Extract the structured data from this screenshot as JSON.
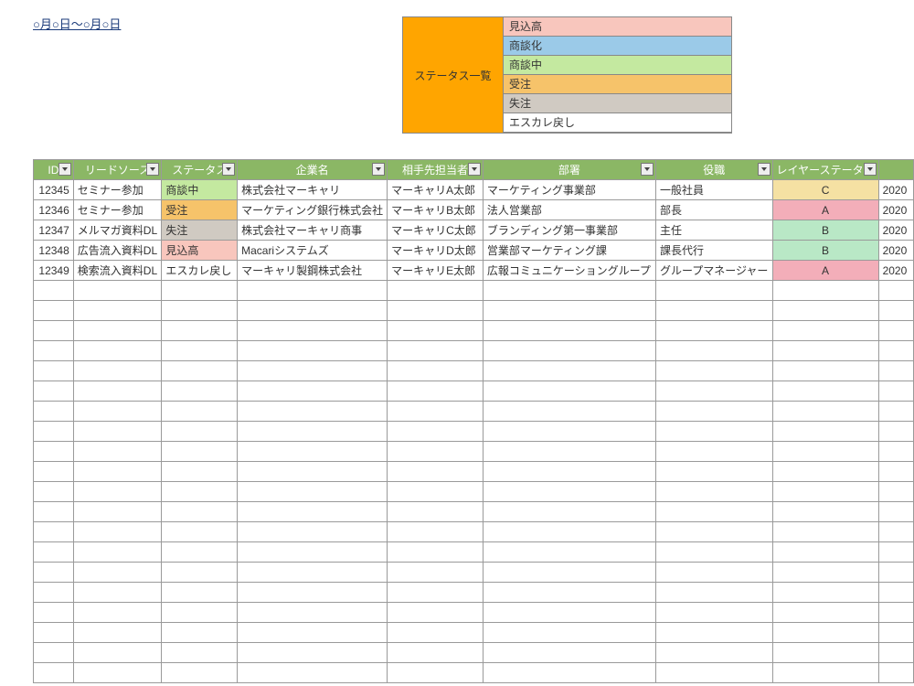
{
  "title_link": "○月○日～○月○日",
  "legend": {
    "header": "ステータス一覧",
    "items": [
      {
        "label": "見込高",
        "class": "bg-mikomi"
      },
      {
        "label": "商談化",
        "class": "bg-shodanka"
      },
      {
        "label": "商談中",
        "class": "bg-shodanchu"
      },
      {
        "label": "受注",
        "class": "bg-juchu"
      },
      {
        "label": "失注",
        "class": "bg-shicchu"
      },
      {
        "label": "エスカレ戻し",
        "class": "bg-escare"
      }
    ]
  },
  "table": {
    "columns": [
      {
        "key": "id",
        "label": "ID"
      },
      {
        "key": "lead",
        "label": "リードソース"
      },
      {
        "key": "status",
        "label": "ステータス"
      },
      {
        "key": "company",
        "label": "企業名"
      },
      {
        "key": "contact",
        "label": "相手先担当者"
      },
      {
        "key": "dept",
        "label": "部署"
      },
      {
        "key": "pos",
        "label": "役職"
      },
      {
        "key": "layer",
        "label": "レイヤーステータス"
      },
      {
        "key": "date",
        "label": ""
      }
    ],
    "rows": [
      {
        "id": "12345",
        "lead": "セミナー参加",
        "status": "商談中",
        "status_class": "bg-shodanchu",
        "company": "株式会社マーキャリ",
        "contact": "マーキャリA太郎",
        "dept": "マーケティング事業部",
        "pos": "一般社員",
        "layer": "C",
        "layer_class": "layer-C",
        "date": "2020"
      },
      {
        "id": "12346",
        "lead": "セミナー参加",
        "status": "受注",
        "status_class": "bg-juchu",
        "company": "マーケティング銀行株式会社",
        "contact": "マーキャリB太郎",
        "dept": "法人営業部",
        "pos": "部長",
        "layer": "A",
        "layer_class": "layer-A",
        "date": "2020"
      },
      {
        "id": "12347",
        "lead": "メルマガ資料DL",
        "status": "失注",
        "status_class": "bg-shicchu",
        "company": "株式会社マーキャリ商事",
        "contact": "マーキャリC太郎",
        "dept": "ブランディング第一事業部",
        "pos": "主任",
        "layer": "B",
        "layer_class": "layer-B",
        "date": "2020"
      },
      {
        "id": "12348",
        "lead": "広告流入資料DL",
        "status": "見込高",
        "status_class": "bg-mikomi",
        "company": "Macariシステムズ",
        "contact": "マーキャリD太郎",
        "dept": "営業部マーケティング課",
        "pos": "課長代行",
        "layer": "B",
        "layer_class": "layer-B",
        "date": "2020"
      },
      {
        "id": "12349",
        "lead": "検索流入資料DL",
        "status": "エスカレ戻し",
        "status_class": "",
        "company": "マーキャリ製鋼株式会社",
        "contact": "マーキャリE太郎",
        "dept": "広報コミュニケーショングループ",
        "pos": "グループマネージャー",
        "layer": "A",
        "layer_class": "layer-A",
        "date": "2020"
      }
    ],
    "empty_rows": 20
  }
}
